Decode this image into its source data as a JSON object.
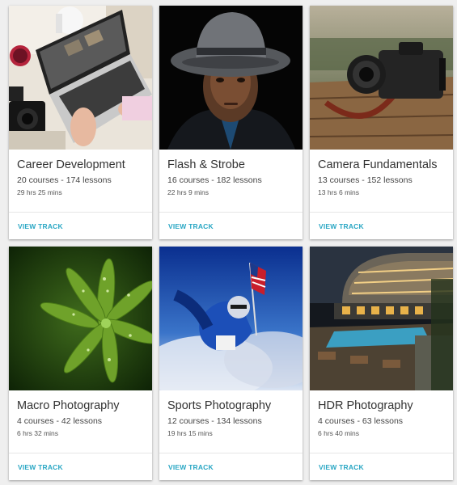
{
  "tracks": [
    {
      "title": "Career Development",
      "stats": "20 courses - 174 lessons",
      "duration": "29 hrs 25 mins",
      "cta": "VIEW TRACK",
      "image": "laptop-desk-photo"
    },
    {
      "title": "Flash & Strobe",
      "stats": "16 courses - 182 lessons",
      "duration": "22 hrs 9 mins",
      "cta": "VIEW TRACK",
      "image": "man-in-fedora-portrait"
    },
    {
      "title": "Camera Fundamentals",
      "stats": "13 courses - 152 lessons",
      "duration": "13 hrs 6 mins",
      "cta": "VIEW TRACK",
      "image": "dslr-camera-on-wood"
    },
    {
      "title": "Macro Photography",
      "stats": "4 courses - 42 lessons",
      "duration": "6 hrs 32 mins",
      "cta": "VIEW TRACK",
      "image": "green-leaf-dewdrops"
    },
    {
      "title": "Sports Photography",
      "stats": "12 courses - 134 lessons",
      "duration": "19 hrs 15 mins",
      "cta": "VIEW TRACK",
      "image": "football-player-with-flag"
    },
    {
      "title": "HDR Photography",
      "stats": "4 courses - 63 lessons",
      "duration": "6 hrs 40 mins",
      "cta": "VIEW TRACK",
      "image": "hdr-building-night"
    }
  ],
  "colors": {
    "accent": "#2aa7c4",
    "background": "#efefef",
    "card": "#ffffff"
  }
}
